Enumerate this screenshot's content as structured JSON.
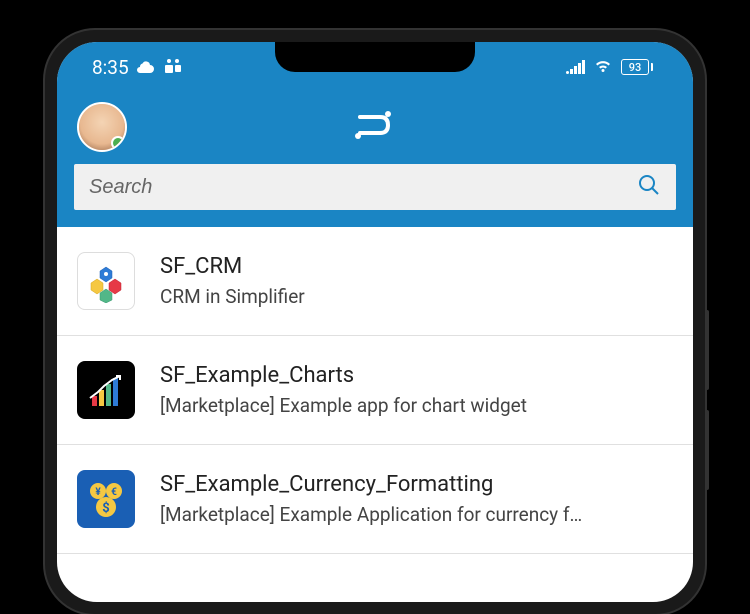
{
  "status_bar": {
    "time": "8:35",
    "battery_level": "93"
  },
  "search": {
    "placeholder": "Search"
  },
  "list": [
    {
      "title": "SF_CRM",
      "subtitle": "CRM in Simplifier"
    },
    {
      "title": "SF_Example_Charts",
      "subtitle": "[Marketplace] Example app for chart widget"
    },
    {
      "title": "SF_Example_Currency_Formatting",
      "subtitle": "[Marketplace] Example Application for currency f…"
    }
  ]
}
